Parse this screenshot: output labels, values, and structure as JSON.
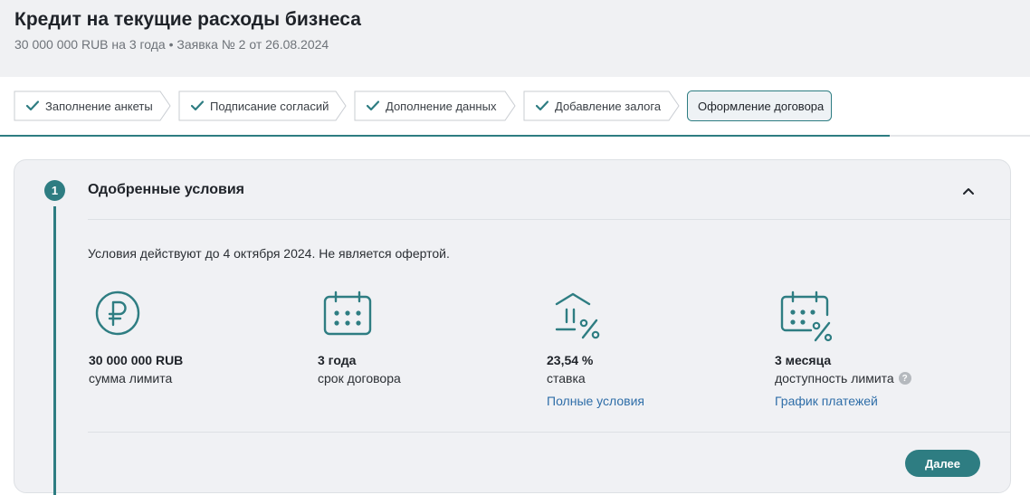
{
  "header": {
    "title": "Кредит на текущие расходы бизнеса",
    "subtitle": "30 000 000 RUB на 3 года • Заявка № 2 от 26.08.2024"
  },
  "steps": [
    {
      "label": "Заполнение анкеты",
      "status": "done"
    },
    {
      "label": "Подписание согласий",
      "status": "done"
    },
    {
      "label": "Дополнение данных",
      "status": "done"
    },
    {
      "label": "Добавление залога",
      "status": "done"
    },
    {
      "label": "Оформление договора",
      "status": "active"
    }
  ],
  "section": {
    "number": "1",
    "title": "Одобренные условия",
    "notice": "Условия действуют до 4 октября 2024. Не является офертой."
  },
  "metrics": [
    {
      "icon": "ruble-icon",
      "value": "30 000 000 RUB",
      "caption": "сумма лимита"
    },
    {
      "icon": "calendar-icon",
      "value": "3 года",
      "caption": "срок договора"
    },
    {
      "icon": "bank-percent-icon",
      "value": "23,54 %",
      "caption": "ставка",
      "link": "Полные условия"
    },
    {
      "icon": "calendar-percent-icon",
      "value": "3 месяца",
      "caption": "доступность лимита",
      "link": "График платежей",
      "help": "?"
    }
  ],
  "actions": {
    "next_label": "Далее"
  },
  "colors": {
    "accent": "#2e7d82",
    "link": "#2f6ea8",
    "header_bg": "#f0f1f3",
    "card_bg": "#f0f1f4"
  }
}
